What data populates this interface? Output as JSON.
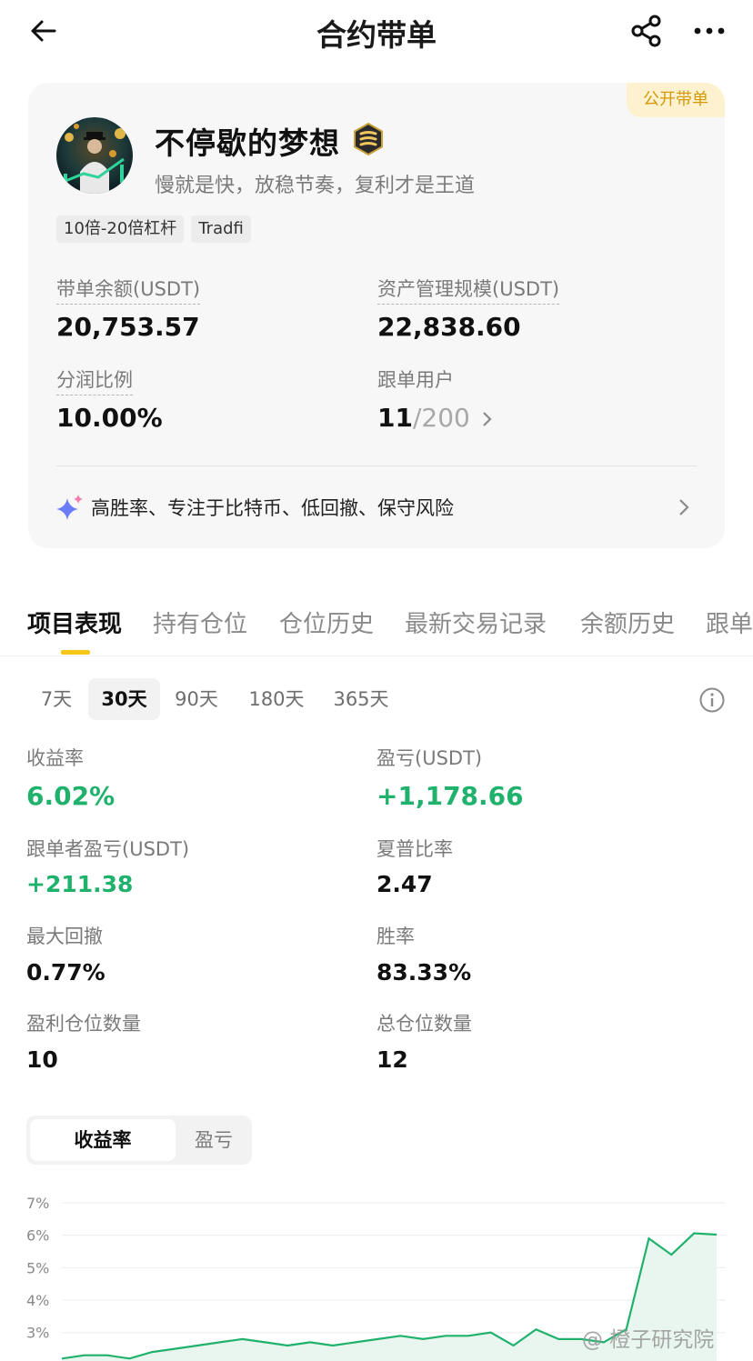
{
  "header": {
    "title": "合约带单"
  },
  "profile": {
    "public_tag": "公开带单",
    "nickname": "不停歇的梦想",
    "motto": "慢就是快，放稳节奏，复利才是王道",
    "tags": [
      "10倍-20倍杠杆",
      "Tradfi"
    ],
    "stats": {
      "lead_balance_label": "带单余额(USDT)",
      "lead_balance": "20,753.57",
      "aum_label": "资产管理规模(USDT)",
      "aum": "22,838.60",
      "profit_share_label": "分润比例",
      "profit_share": "10.00%",
      "followers_label": "跟单用户",
      "followers_count": "11",
      "followers_max": "/200"
    },
    "ai_summary": "高胜率、专注于比特币、低回撤、保守风险"
  },
  "tabs": [
    "项目表现",
    "持有仓位",
    "仓位历史",
    "最新交易记录",
    "余额历史",
    "跟单"
  ],
  "periods": [
    "7天",
    "30天",
    "90天",
    "180天",
    "365天"
  ],
  "selected_period": "30天",
  "metrics": {
    "roi_label": "收益率",
    "roi": "6.02%",
    "pnl_label": "盈亏(USDT)",
    "pnl": "+1,178.66",
    "copier_pnl_label": "跟单者盈亏(USDT)",
    "copier_pnl": "+211.38",
    "sharpe_label": "夏普比率",
    "sharpe": "2.47",
    "mdd_label": "最大回撤",
    "mdd": "0.77%",
    "winrate_label": "胜率",
    "winrate": "83.33%",
    "win_positions_label": "盈利仓位数量",
    "win_positions": "10",
    "total_positions_label": "总仓位数量",
    "total_positions": "12"
  },
  "chart_toggle": {
    "active": "收益率",
    "inactive": "盈亏"
  },
  "chart_data": {
    "type": "area",
    "y_ticks": [
      "7%",
      "6%",
      "5%",
      "4%",
      "3%"
    ],
    "ylim": [
      2.6,
      7.0
    ],
    "x": [
      0,
      1,
      2,
      3,
      4,
      5,
      6,
      7,
      8,
      9,
      10,
      11,
      12,
      13,
      14,
      15,
      16,
      17,
      18,
      19,
      20,
      21,
      22,
      23,
      24,
      25,
      26,
      27,
      28,
      29
    ],
    "values": [
      2.2,
      2.3,
      2.3,
      2.2,
      2.4,
      2.5,
      2.6,
      2.7,
      2.8,
      2.7,
      2.6,
      2.7,
      2.6,
      2.7,
      2.8,
      2.9,
      2.8,
      2.9,
      2.9,
      3.0,
      2.6,
      3.1,
      2.8,
      2.8,
      2.7,
      3.1,
      5.9,
      5.4,
      6.06,
      6.02
    ],
    "line_color": "#20b26c",
    "fill_color": "#e8f6ef",
    "grid": true
  },
  "watermark": "@ 橙子研究院"
}
